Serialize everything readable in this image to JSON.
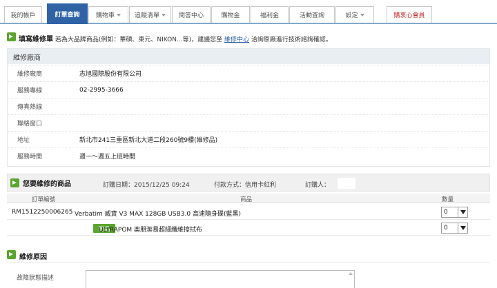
{
  "tabs": [
    {
      "label": "我的帳戶",
      "active": false,
      "dropdown": false
    },
    {
      "label": "訂單查詢",
      "active": true,
      "dropdown": false
    },
    {
      "label": "購物車",
      "active": false,
      "dropdown": true
    },
    {
      "label": "追蹤清單",
      "active": false,
      "dropdown": true
    },
    {
      "label": "問答中心",
      "active": false,
      "dropdown": false
    },
    {
      "label": "購物金",
      "active": false,
      "dropdown": false
    },
    {
      "label": "福利金",
      "active": false,
      "dropdown": false
    },
    {
      "label": "活動查詢",
      "active": false,
      "dropdown": false
    },
    {
      "label": "設定",
      "active": false,
      "dropdown": true
    },
    {
      "label": "購衷心會員",
      "active": false,
      "dropdown": false
    }
  ],
  "notice": {
    "title": "填寫維修單",
    "text_before": "若為大品牌商品(例如：華碩、東元、NIKON...等)，建議您至",
    "link": "維修中心",
    "text_after": "洽詢原廠進行技術諮詢確認。"
  },
  "vendor": {
    "heading": "維修廠商",
    "rows": [
      {
        "label": "維修廠商",
        "value": "志旭國際股份有限公司"
      },
      {
        "label": "服務專線",
        "value": "02-2995-3666"
      },
      {
        "label": "傳真熱線",
        "value": ""
      },
      {
        "label": "聯絡窗口",
        "value": ""
      },
      {
        "label": "地址",
        "value": "新北市241三重區新北大道二段260號9樓(維修品)"
      },
      {
        "label": "服務時間",
        "value": "週一～週五上班時間"
      }
    ]
  },
  "items_section": {
    "title": "您要維修的商品",
    "order_date": "訂購日期：2015/12/25 09:24",
    "payment": "付款方式：信用卡紅利",
    "buyer_label": "訂購人："
  },
  "columns": {
    "order_no": "訂單編號",
    "product": "商品",
    "qty": "數量"
  },
  "items": [
    {
      "order_no": "RM1512250006265",
      "product": "Verbatim 威寶 V3 MAX 128GB USB3.0 高速隨身碟(藍黑)",
      "qty": "0",
      "gift": false
    },
    {
      "order_no": "",
      "product": "ULTRAPOM 奧朋潔易超細纖維擦拭布",
      "qty": "0",
      "gift": true,
      "gift_label": "贈品"
    }
  ],
  "reason": {
    "title": "維修原因",
    "label": "故障狀態描述",
    "value": ""
  },
  "colors": {
    "tab_active": "#2f63a6",
    "accent_green": "#5aa52c",
    "link": "#2c5ea8"
  },
  "icons": {
    "section_marker": "green-arrow-icon",
    "select_arrow": "chevron-down-icon"
  }
}
